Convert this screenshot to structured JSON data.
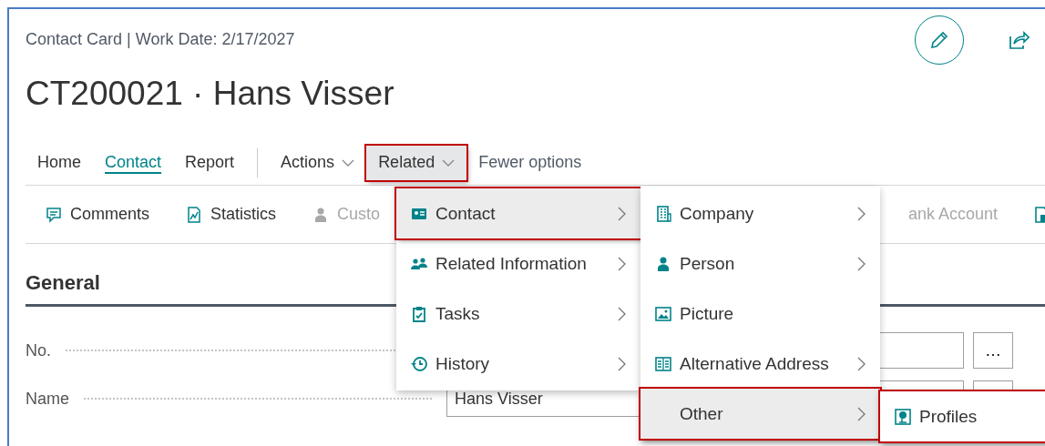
{
  "header": {
    "caption": "Contact Card | Work Date: 2/17/2027",
    "title": "CT200021 · Hans Visser"
  },
  "tabs": [
    {
      "label": "Home",
      "kind": "tab",
      "selected": false,
      "annotated": false
    },
    {
      "label": "Contact",
      "kind": "tab",
      "selected": true,
      "annotated": false
    },
    {
      "label": "Report",
      "kind": "tab",
      "selected": false,
      "annotated": false
    },
    {
      "label": "Actions",
      "kind": "menu",
      "selected": false,
      "annotated": false
    },
    {
      "label": "Related",
      "kind": "menu",
      "selected": true,
      "annotated": true
    },
    {
      "label": "Fewer options",
      "kind": "link",
      "annotated": false
    }
  ],
  "actions": [
    {
      "label": "Comments",
      "disabled": false
    },
    {
      "label": "Statistics",
      "disabled": false
    },
    {
      "label": "Custo",
      "disabled": true
    },
    {
      "label": "ank Account",
      "disabled": true
    },
    {
      "disabled": false
    }
  ],
  "section": {
    "title": "General",
    "fields": [
      {
        "label": "No.",
        "button": "…"
      },
      {
        "label": "Name",
        "value": "Hans Visser",
        "has_button": true
      }
    ]
  },
  "menus": [
    {
      "items": [
        {
          "label": "Contact",
          "submenu": true,
          "selected": true,
          "annotated": true
        },
        {
          "label": "Related Information",
          "submenu": true,
          "selected": false,
          "annotated": false
        },
        {
          "label": "Tasks",
          "submenu": true,
          "selected": false,
          "annotated": false
        },
        {
          "label": "History",
          "submenu": true,
          "selected": false,
          "annotated": false
        }
      ]
    },
    {
      "items": [
        {
          "label": "Company",
          "submenu": true,
          "selected": false,
          "annotated": false
        },
        {
          "label": "Person",
          "submenu": true,
          "selected": false,
          "annotated": false
        },
        {
          "label": "Picture",
          "submenu": false,
          "selected": false,
          "annotated": false
        },
        {
          "label": "Alternative Address",
          "submenu": true,
          "selected": false,
          "annotated": false
        },
        {
          "label": "Other",
          "submenu": true,
          "selected": true,
          "annotated": true
        }
      ]
    },
    {
      "items": [
        {
          "label": "Profiles",
          "submenu": false,
          "selected": false,
          "annotated": true
        }
      ]
    }
  ]
}
